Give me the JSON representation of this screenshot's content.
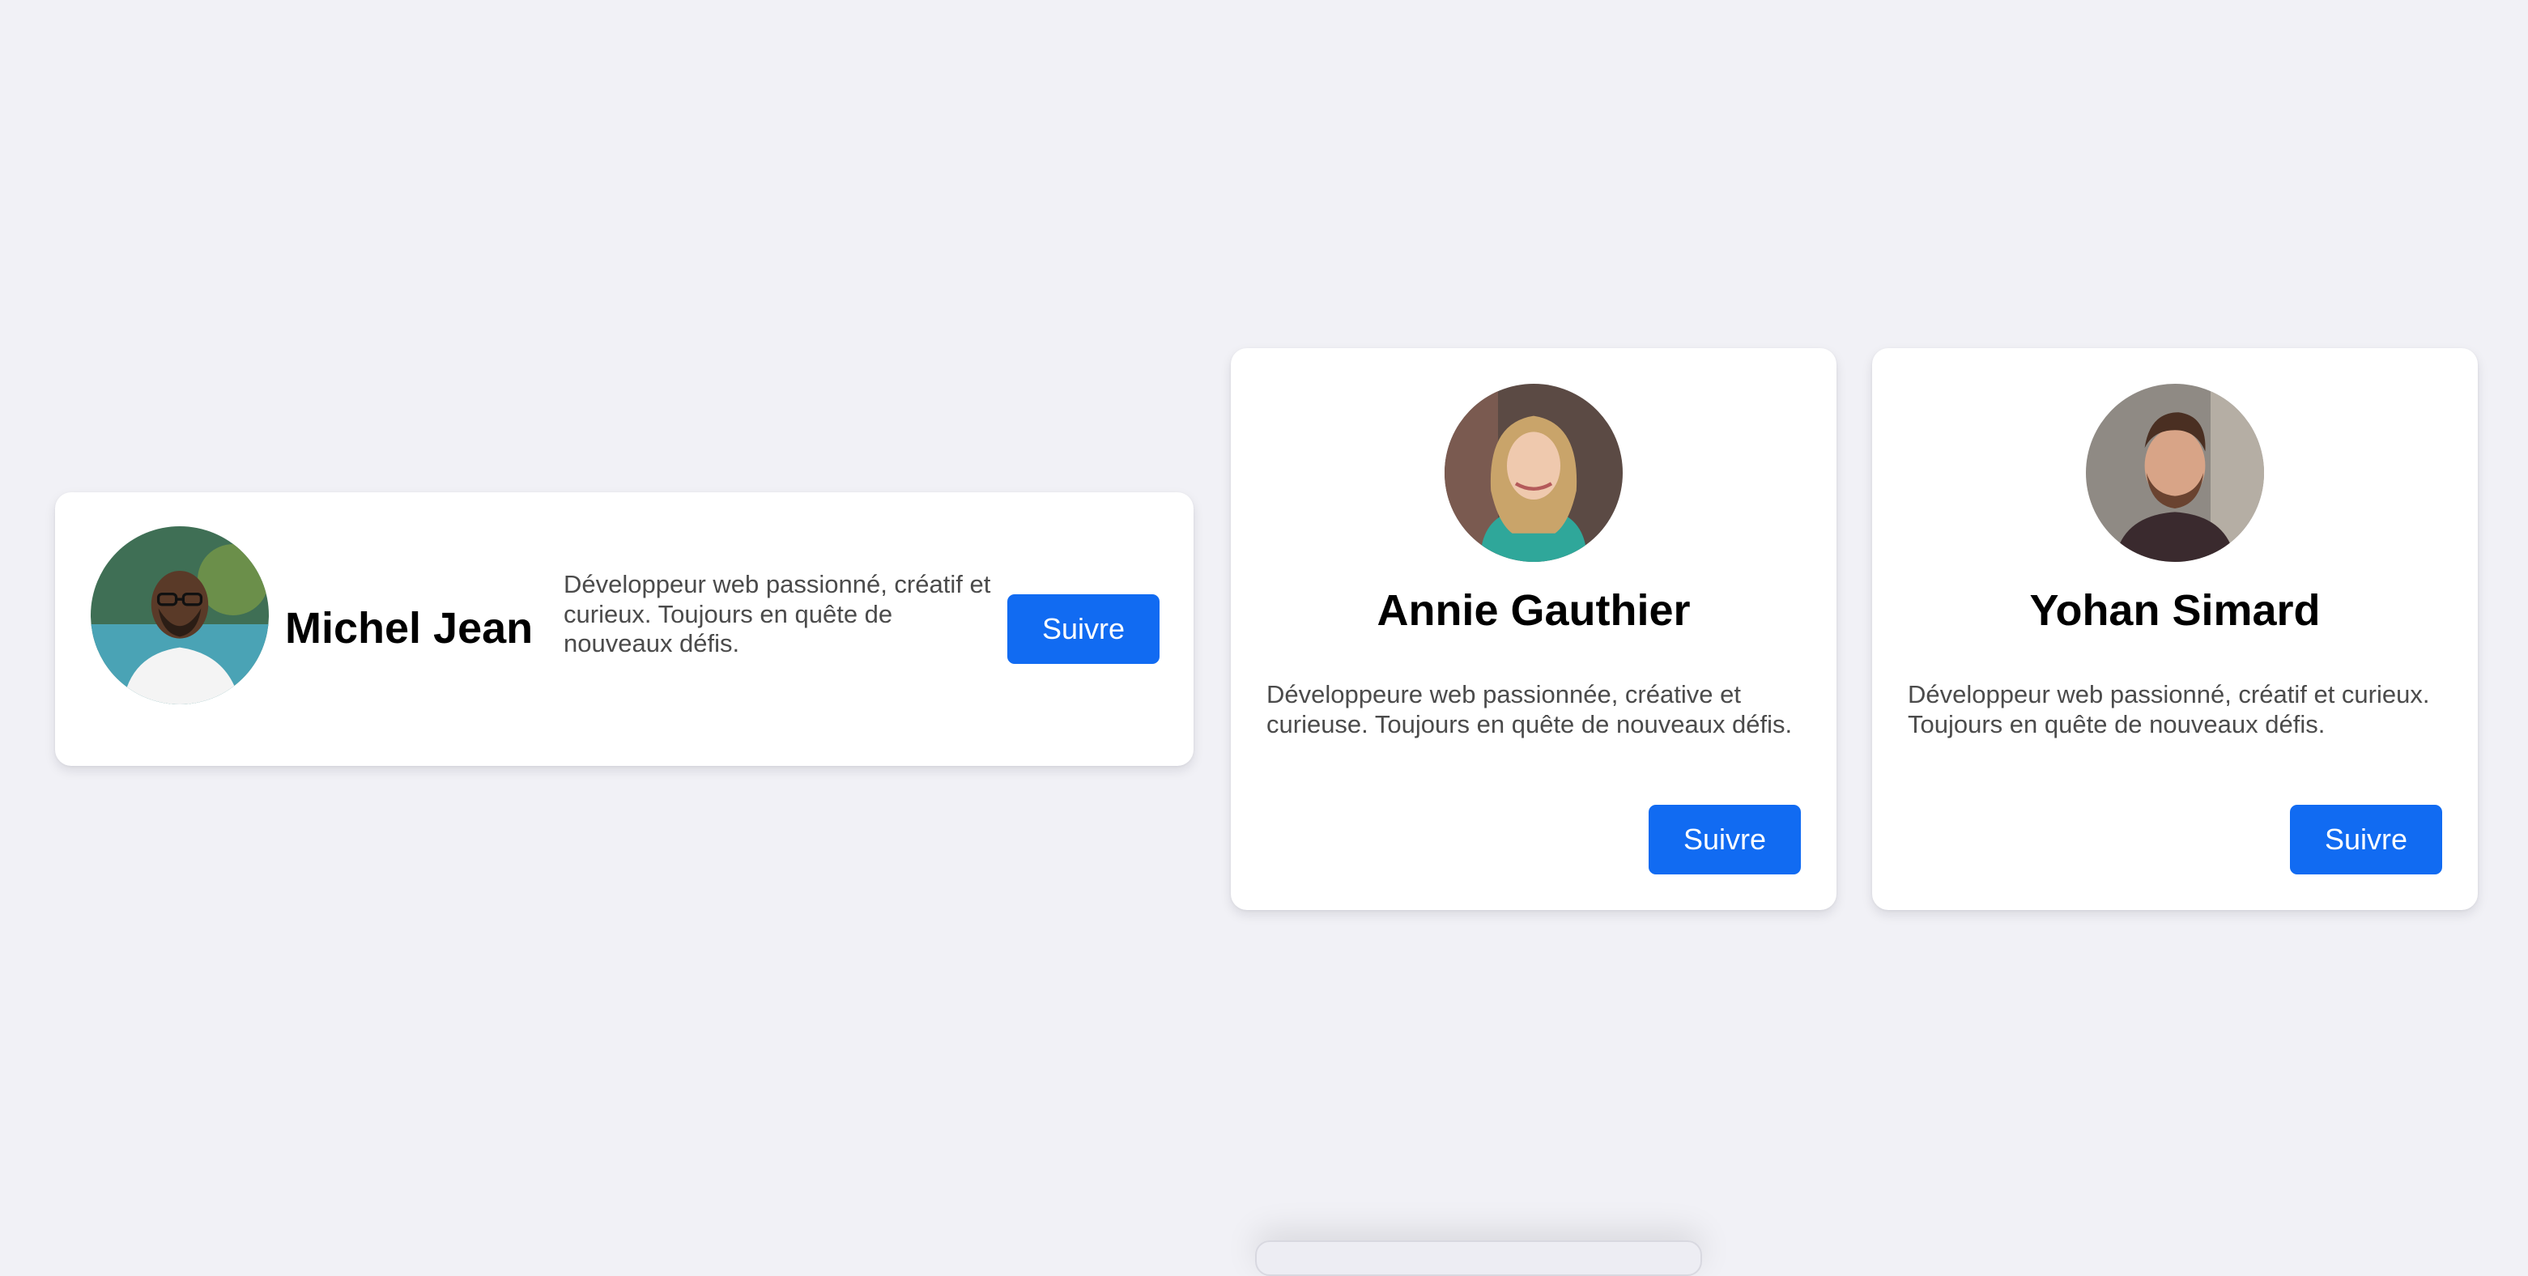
{
  "profiles": {
    "michel": {
      "name": "Michel Jean",
      "bio": "Développeur web passionné, créatif et curieux. Toujours en quête de nouveaux défis.",
      "follow_label": "Suivre"
    },
    "annie": {
      "name": "Annie Gauthier",
      "bio": "Développeure web passionnée, créative et curieuse. Toujours en quête de nouveaux défis.",
      "follow_label": "Suivre"
    },
    "yohan": {
      "name": "Yohan Simard",
      "bio": "Développeur web passionné, créatif et curieux. Toujours en quête de nouveaux défis.",
      "follow_label": "Suivre"
    }
  },
  "colors": {
    "background": "#f1f1f6",
    "card": "#ffffff",
    "accent": "#116bf2",
    "bio_text": "#4b4b4b"
  }
}
